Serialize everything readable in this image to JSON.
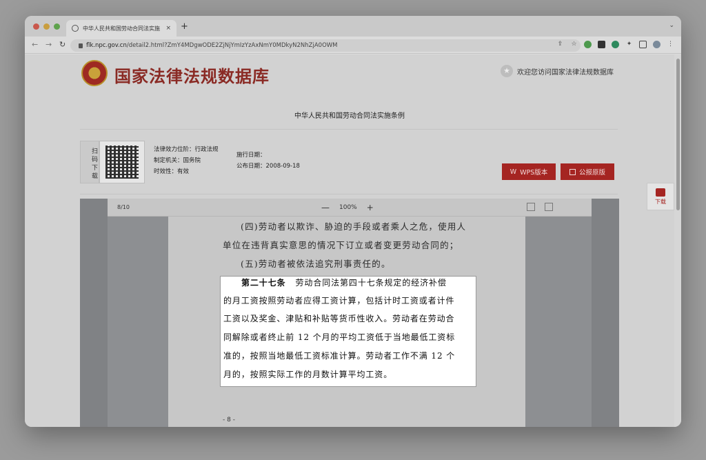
{
  "browser": {
    "tab_title": "中华人民共和国劳动合同法实施",
    "tab_close": "×",
    "new_tab": "+",
    "url_host": "flk.npc.gov.cn",
    "url_path": "/detail2.html?ZmY4MDgwODE2ZjNjYmIzYzAxNmY0MDkyN2NhZjA0OWM"
  },
  "site": {
    "title": "国家法律法规数据库",
    "welcome": "欢迎您访问国家法律法规数据库",
    "doc_heading": "中华人民共和国劳动合同法实施条例"
  },
  "meta": {
    "qr_label": "扫码下载",
    "level_label": "法律效力位阶：行政法规",
    "authority_label": "制定机关：国务院",
    "validity_label": "时效性：有效",
    "effective_date_label": "施行日期：",
    "publish_date_label": "公布日期：2008-09-18"
  },
  "buttons": {
    "wps": "WPS版本",
    "original": "公报原版",
    "download": "下载"
  },
  "pdf": {
    "page_indicator": "8/10",
    "zoom_minus": "—",
    "zoom": "100%",
    "zoom_plus": "+",
    "lines": [
      "(四)劳动者以欺诈、胁迫的手段或者乘人之危，使用人",
      "单位在违背真实意思的情况下订立或者变更劳动合同的；",
      "(五)劳动者被依法追究刑事责任的。"
    ],
    "article_heading": "第二十七条",
    "article_lines": [
      "劳动合同法第四十七条规定的经济补偿",
      "的月工资按照劳动者应得工资计算，包括计时工资或者计件",
      "工资以及奖金、津贴和补贴等货币性收入。劳动者在劳动合",
      "同解除或者终止前 12 个月的平均工资低于当地最低工资标",
      "准的，按照当地最低工资标准计算。劳动者工作不满 12 个",
      "月的，按照实际工作的月数计算平均工资。"
    ],
    "page_number": "- 8 -"
  }
}
